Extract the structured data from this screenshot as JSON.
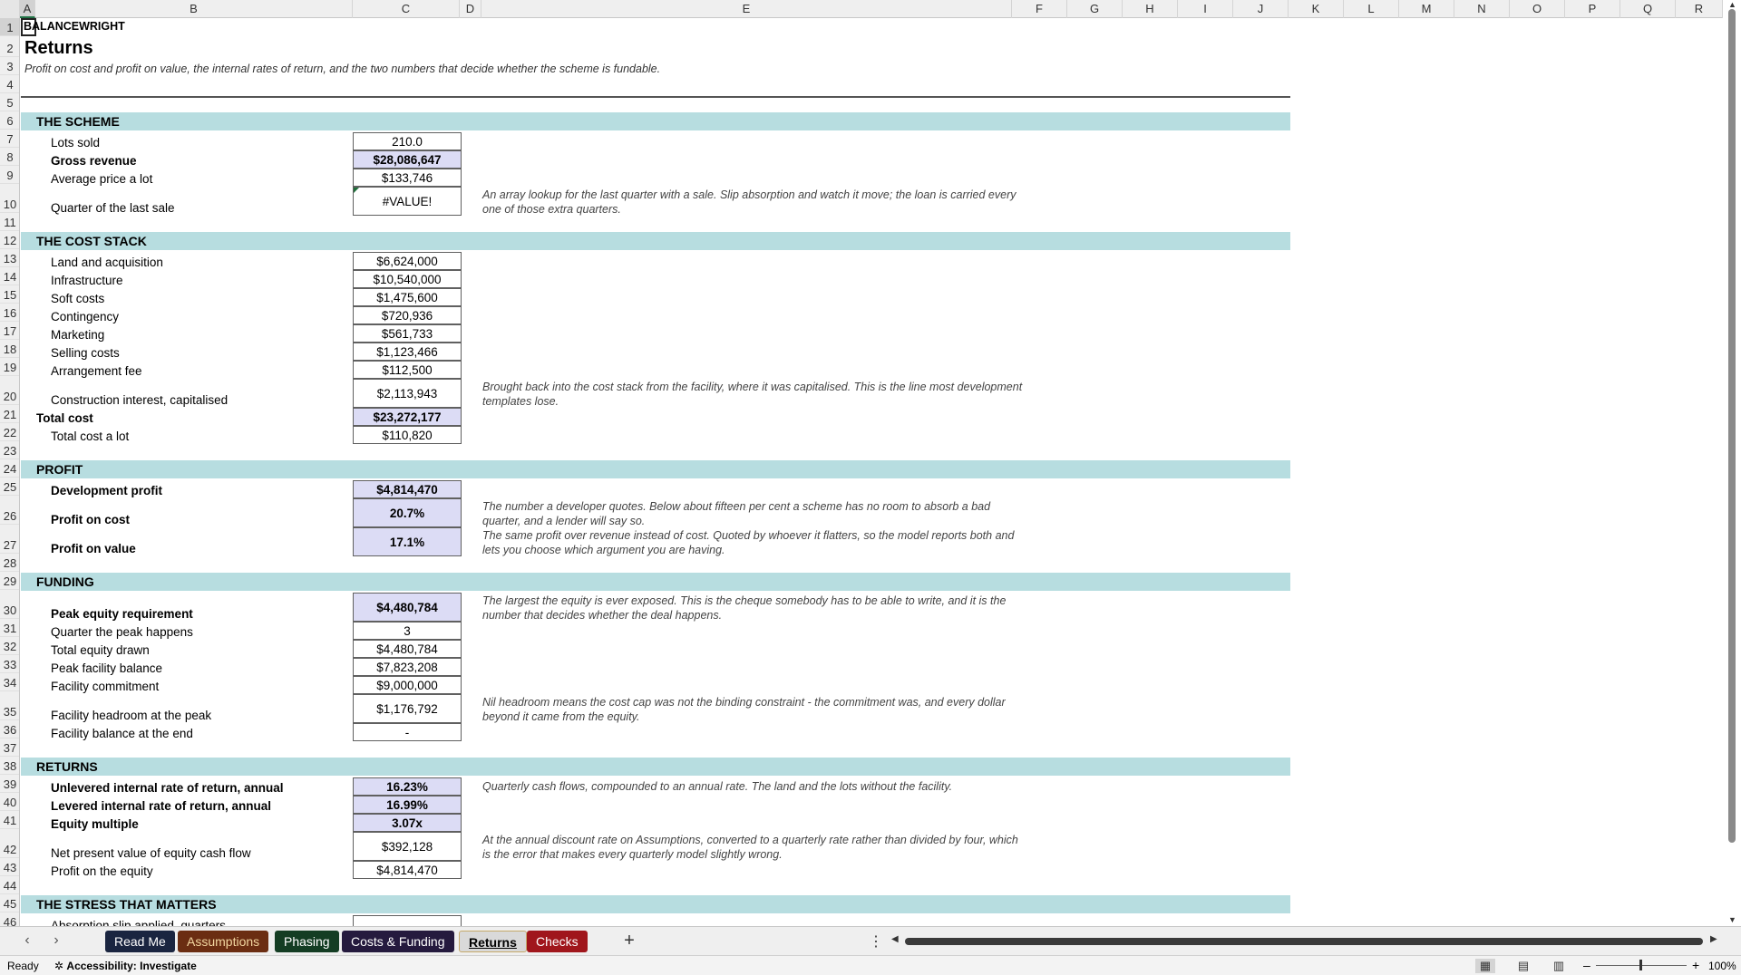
{
  "columns": [
    "A",
    "B",
    "C",
    "D",
    "E",
    "F",
    "G",
    "H",
    "I",
    "J",
    "K",
    "L",
    "M",
    "N",
    "O",
    "P",
    "Q",
    "R"
  ],
  "rows": [
    "1",
    "2",
    "3",
    "4",
    "5",
    "6",
    "7",
    "8",
    "9",
    "10",
    "11",
    "12",
    "13",
    "14",
    "15",
    "16",
    "17",
    "18",
    "19",
    "20",
    "21",
    "22",
    "23",
    "24",
    "25",
    "26",
    "27",
    "28",
    "29",
    "30",
    "31",
    "32",
    "33",
    "34",
    "35",
    "36",
    "37",
    "38",
    "39",
    "40",
    "41",
    "42",
    "43",
    "44",
    "45",
    "46"
  ],
  "brand": "BALANCEWRIGHT",
  "title": "Returns",
  "subtitle": "Profit on cost and profit on value, the internal rates of return, and the two numbers that decide whether the scheme is fundable.",
  "sections": {
    "scheme": "THE SCHEME",
    "cost": "THE COST STACK",
    "profit": "PROFIT",
    "funding": "FUNDING",
    "returns": "RETURNS",
    "stress": "THE STRESS THAT MATTERS"
  },
  "rows_data": {
    "r7": {
      "label": "Lots sold",
      "value": "210.0"
    },
    "r8": {
      "label": "Gross revenue",
      "value": "$28,086,647"
    },
    "r9": {
      "label": "Average price a lot",
      "value": "$133,746"
    },
    "r10": {
      "label": "Quarter of the last sale",
      "value": "#VALUE!",
      "note": "An array lookup for the last quarter with a sale. Slip absorption and watch it move; the loan is carried every one of those extra quarters."
    },
    "r13": {
      "label": "Land and acquisition",
      "value": "$6,624,000"
    },
    "r14": {
      "label": "Infrastructure",
      "value": "$10,540,000"
    },
    "r15": {
      "label": "Soft costs",
      "value": "$1,475,600"
    },
    "r16": {
      "label": "Contingency",
      "value": "$720,936"
    },
    "r17": {
      "label": "Marketing",
      "value": "$561,733"
    },
    "r18": {
      "label": "Selling costs",
      "value": "$1,123,466"
    },
    "r19": {
      "label": "Arrangement fee",
      "value": "$112,500"
    },
    "r20": {
      "label": "Construction interest, capitalised",
      "value": "$2,113,943",
      "note": "Brought back into the cost stack from the facility, where it was capitalised. This is the line most development templates lose."
    },
    "r21": {
      "label": "Total cost",
      "value": "$23,272,177"
    },
    "r22": {
      "label": "Total cost a lot",
      "value": "$110,820"
    },
    "r25": {
      "label": "Development profit",
      "value": "$4,814,470"
    },
    "r26": {
      "label": "Profit on cost",
      "value": "20.7%",
      "note": "The number a developer quotes. Below about fifteen per cent a scheme has no room to absorb a bad quarter, and a lender will say so."
    },
    "r27": {
      "label": "Profit on value",
      "value": "17.1%",
      "note": "The same profit over revenue instead of cost. Quoted by whoever it flatters, so the model reports both and lets you choose which argument you are having."
    },
    "r30": {
      "label": "Peak equity requirement",
      "value": "$4,480,784",
      "note": "The largest the equity is ever exposed. This is the cheque somebody has to be able to write, and it is the number that decides whether the deal happens."
    },
    "r31": {
      "label": "Quarter the peak happens",
      "value": "3"
    },
    "r32": {
      "label": "Total equity drawn",
      "value": "$4,480,784"
    },
    "r33": {
      "label": "Peak facility balance",
      "value": "$7,823,208"
    },
    "r34": {
      "label": "Facility commitment",
      "value": "$9,000,000"
    },
    "r35": {
      "label": "Facility headroom at the peak",
      "value": "$1,176,792",
      "note": "Nil headroom means the cost cap was not the binding constraint - the commitment was, and every dollar beyond it came from the equity."
    },
    "r36": {
      "label": "Facility balance at the end",
      "value": "-"
    },
    "r39": {
      "label": "Unlevered internal rate of return, annual",
      "value": "16.23%",
      "note": "Quarterly cash flows, compounded to an annual rate. The land and the lots without the facility."
    },
    "r40": {
      "label": "Levered internal rate of return, annual",
      "value": "16.99%"
    },
    "r41": {
      "label": "Equity multiple",
      "value": "3.07x"
    },
    "r42": {
      "label": "Net present value of equity cash flow",
      "value": "$392,128",
      "note": "At the annual discount rate on Assumptions, converted to a quarterly rate rather than divided by four, which is the error that makes every quarterly model slightly wrong."
    },
    "r43": {
      "label": "Profit on the equity",
      "value": "$4,814,470"
    },
    "r46": {
      "label": "Absorption slip applied, quarters",
      "value": ""
    }
  },
  "tabs": [
    {
      "label": "Read Me",
      "bg": "#1a2540",
      "fg": "#ffffff"
    },
    {
      "label": "Assumptions",
      "bg": "#6b2d12",
      "fg": "#f2d6a0"
    },
    {
      "label": "Phasing",
      "bg": "#143d23",
      "fg": "#ffffff"
    },
    {
      "label": "Costs & Funding",
      "bg": "#251a3e",
      "fg": "#ffffff"
    },
    {
      "label": "Returns",
      "bg": "#d9d9d9",
      "fg": "#000000"
    },
    {
      "label": "Checks",
      "bg": "#a0161c",
      "fg": "#ffffff"
    }
  ],
  "status": {
    "ready": "Ready",
    "accessibility_prefix": "Accessibility:",
    "accessibility_value": "Investigate",
    "zoom": "100%"
  }
}
